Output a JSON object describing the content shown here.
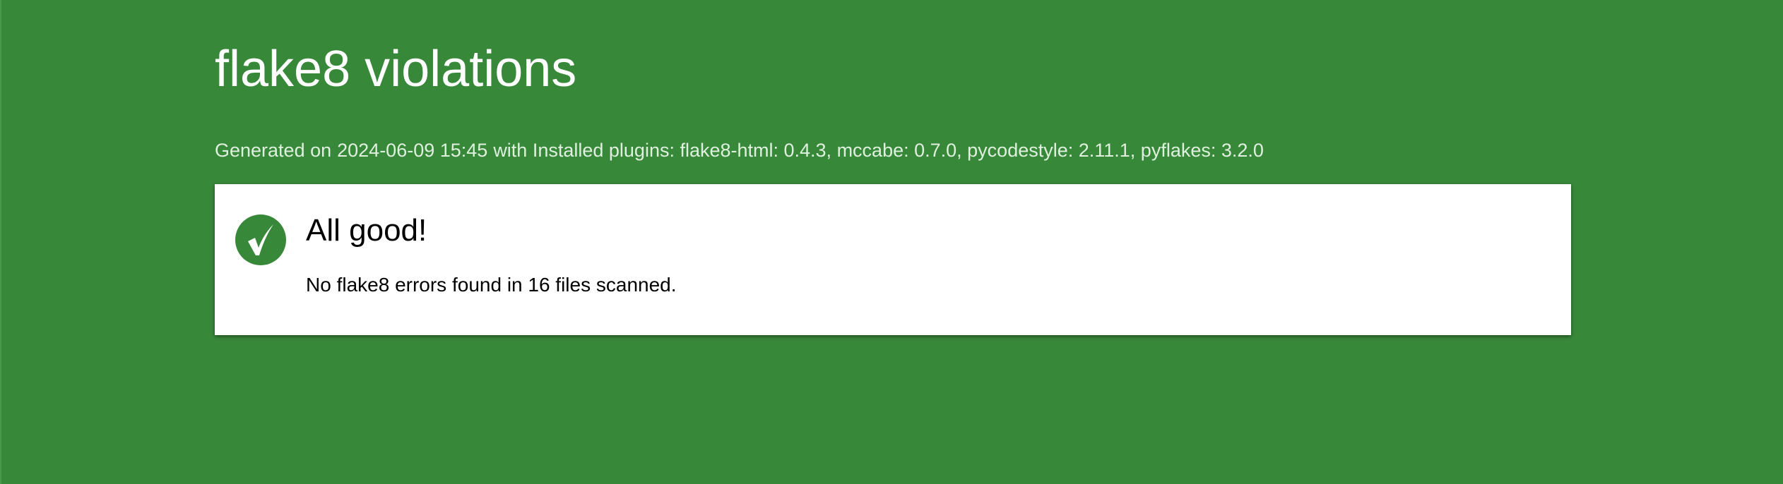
{
  "page": {
    "title": "flake8 violations",
    "generated_prefix": "Generated on",
    "generated_date": "2024-06-09 15:45",
    "plugins_text": "with Installed plugins: flake8-html: 0.4.3, mccabe: 0.7.0, pycodestyle: 2.11.1, pyflakes: 3.2.0"
  },
  "result": {
    "icon": "checkmark-icon",
    "heading": "All good!",
    "message": "No flake8 errors found in 16 files scanned."
  },
  "colors": {
    "background": "#38883a",
    "card": "#ffffff",
    "badge": "#38883a"
  }
}
